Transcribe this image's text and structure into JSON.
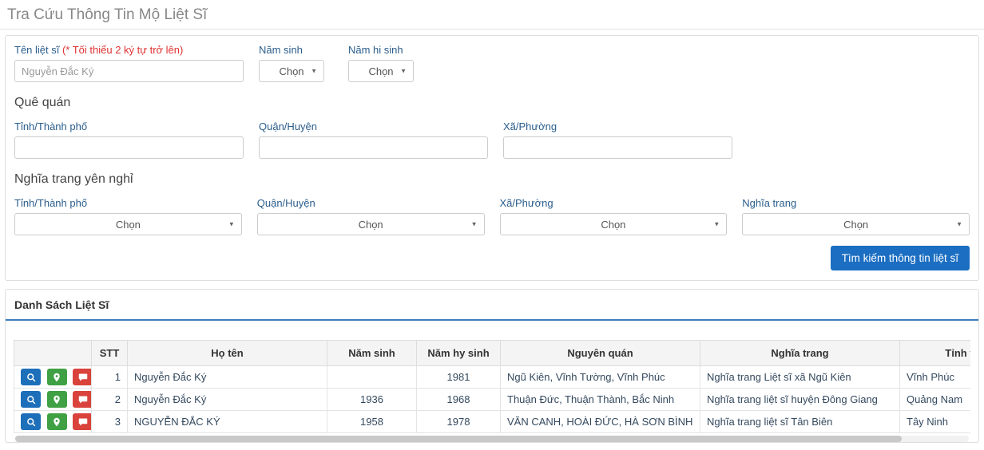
{
  "page_title": "Tra Cứu Thông Tin Mộ Liệt Sĩ",
  "search_form": {
    "name_label": "Tên liệt sĩ ",
    "name_required_hint": "(* Tối thiểu 2 ký tự trở lên)",
    "name_value": "Nguyễn Đắc Ký",
    "birth_year_label": "Năm sinh",
    "death_year_label": "Năm hi sinh",
    "select_placeholder": "Chọn",
    "hometown": {
      "section_title": "Quê quán",
      "province_label": "Tỉnh/Thành phố",
      "district_label": "Quận/Huyện",
      "ward_label": "Xã/Phường"
    },
    "cemetery": {
      "section_title": "Nghĩa trang yên nghỉ",
      "province_label": "Tỉnh/Thành phố",
      "district_label": "Quận/Huyện",
      "ward_label": "Xã/Phường",
      "cemetery_label": "Nghĩa trang"
    },
    "submit_label": "Tìm kiếm thông tin liệt sĩ"
  },
  "results": {
    "panel_title": "Danh Sách Liệt Sĩ",
    "columns": [
      "",
      "STT",
      "Họ tên",
      "Năm sinh",
      "Năm hy sinh",
      "Nguyên quán",
      "Nghĩa trang",
      "Tỉnh thành"
    ],
    "action_icons": [
      "search-icon",
      "location-pin-icon",
      "comment-icon"
    ],
    "rows": [
      {
        "stt": "1",
        "name": "Nguyễn Đắc Ký",
        "birth": "",
        "death": "1981",
        "origin": "Ngũ Kiên, Vĩnh Tường, Vĩnh Phúc",
        "cemetery": "Nghĩa trang Liệt sĩ xã Ngũ Kiên",
        "province": "Vĩnh Phúc"
      },
      {
        "stt": "2",
        "name": "Nguyễn Đắc Ký",
        "birth": "1936",
        "death": "1968",
        "origin": "Thuận Đức, Thuận Thành, Bắc Ninh",
        "cemetery": "Nghĩa trang liệt sĩ huyện Đông Giang",
        "province": "Quảng Nam"
      },
      {
        "stt": "3",
        "name": "NGUYỄN ĐẮC KÝ",
        "birth": "1958",
        "death": "1978",
        "origin": "VĂN CANH, HOÀI ĐỨC, HÀ SƠN BÌNH",
        "cemetery": "Nghĩa trang liệt sĩ Tân Biên",
        "province": "Tây Ninh"
      }
    ]
  },
  "colors": {
    "accent_blue": "#1b6ec2",
    "header_underline": "#3b7dbd",
    "required_red": "#e03131",
    "label_blue": "#2a5d8c",
    "action_blue": "#1e6fba",
    "action_green": "#3fa044",
    "action_red": "#d9433b"
  }
}
